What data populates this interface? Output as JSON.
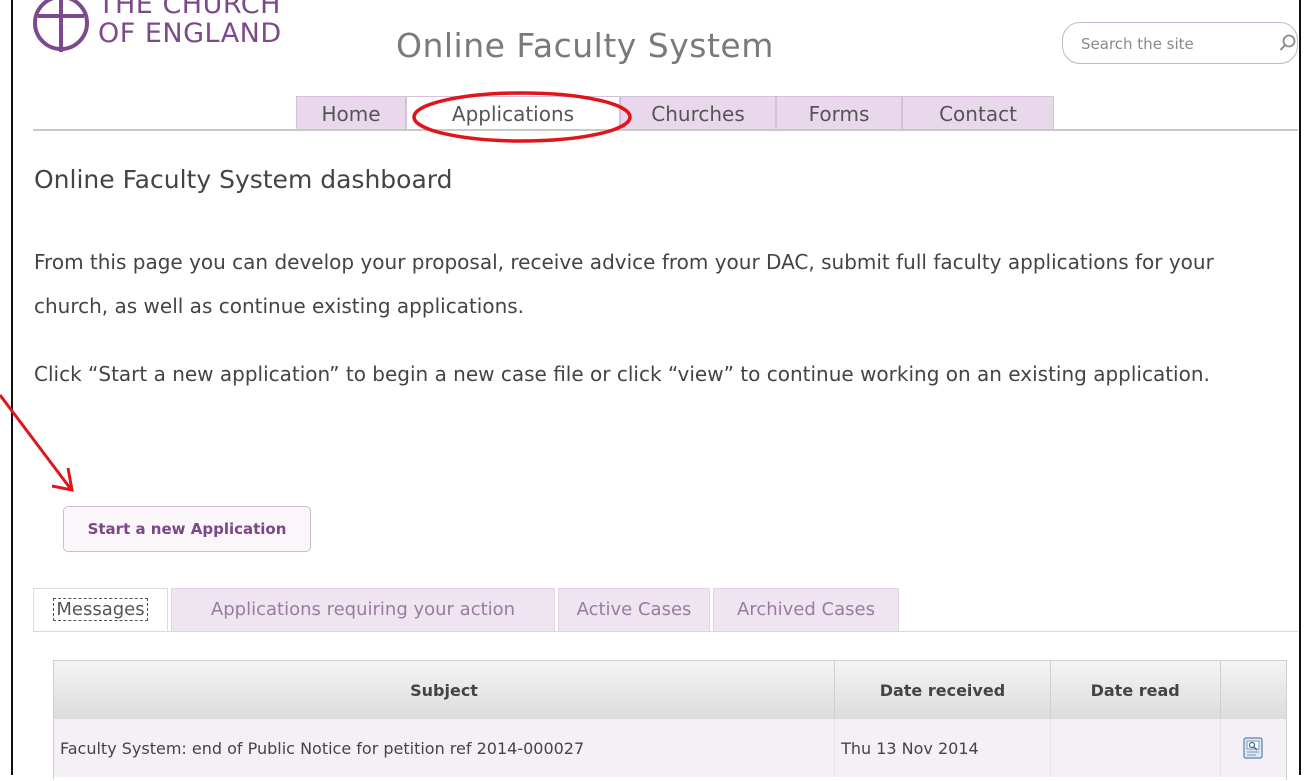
{
  "brand": {
    "name_line1": "THE CHURCH",
    "name_line2": "OF ENGLAND",
    "color": "#7c4a8c"
  },
  "site_title": "Online Faculty System",
  "search": {
    "placeholder": "Search the site",
    "icon": "search-icon"
  },
  "nav": {
    "tabs": [
      {
        "label": "Home"
      },
      {
        "label": "Applications",
        "selected": true
      },
      {
        "label": "Churches"
      },
      {
        "label": "Forms"
      },
      {
        "label": "Contact"
      }
    ]
  },
  "page": {
    "title": "Online Faculty System dashboard",
    "intro": "From this page you can develop your proposal, receive advice from your DAC, submit full faculty applications for your church, as well as continue existing applications.",
    "instructions": "Click “Start a new application” to begin a new case file or click “view” to continue working on an existing application.",
    "start_button": "Start a new Application"
  },
  "tabs": [
    {
      "label": "Messages",
      "selected": true
    },
    {
      "label": "Applications requiring your action"
    },
    {
      "label": "Active Cases"
    },
    {
      "label": "Archived Cases"
    }
  ],
  "messages_table": {
    "columns": [
      "Subject",
      "Date received",
      "Date read",
      ""
    ],
    "rows": [
      {
        "subject": "Faculty System: end of Public Notice for petition ref 2014-000027",
        "date_received": "Thu 13 Nov 2014",
        "date_read": "",
        "action_icon": "view-icon"
      }
    ]
  },
  "colors": {
    "accent": "#7c4a8c",
    "tab_bg": "#e9d8ec",
    "annotation": "#e0151b"
  }
}
